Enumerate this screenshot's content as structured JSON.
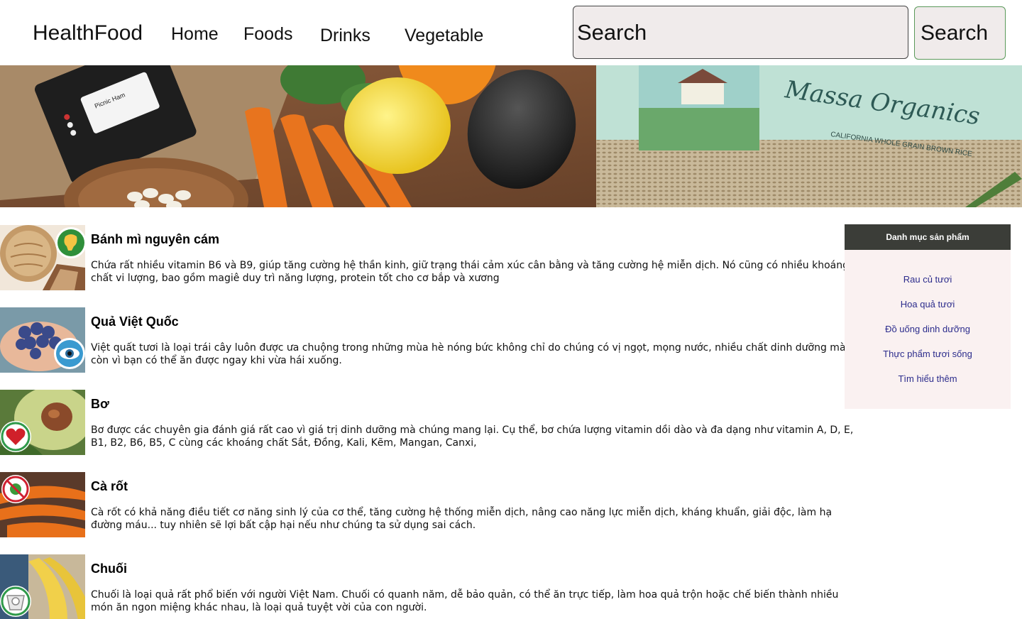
{
  "header": {
    "brand": "HealthFood",
    "nav": [
      "Home",
      "Foods",
      "Drinks",
      "Vegetable"
    ],
    "search_placeholder": "Search",
    "search_button": "Search"
  },
  "sidebar": {
    "title": "Danh mục sản phẩm",
    "links": [
      "Rau củ tươi",
      "Hoa quả tươi",
      "Đồ uống dinh dưỡng",
      "Thực phẩm tươi sống",
      "Tìm hiểu thêm"
    ]
  },
  "banner": {
    "label_picnic": "Picnic Ham",
    "label_brand": "Massa Organics",
    "label_rice": "CALIFORNIA WHOLE GRAIN BROWN RICE"
  },
  "articles": [
    {
      "title": "Bánh mì nguyên cám",
      "desc": "Chứa rất nhiều vitamin B6 và B9, giúp tăng cường hệ thần kinh, giữ trạng thái cảm xúc cân bằng và tăng cường hệ miễn dịch. Nó cũng có nhiều khoáng chất vi lượng, bao gồm magiê duy trì năng lượng, protein tốt cho cơ bắp và xương",
      "badge_icon": "brain-icon"
    },
    {
      "title": "Quả Việt Quốc",
      "desc": "Việt quất tươi là loại trái cây luôn được ưa chuộng trong những mùa hè nóng bức không chỉ do chúng có vị ngọt, mọng nước, nhiều chất dinh dưỡng mà còn vì bạn có thể ăn được ngay khi vừa hái xuống.",
      "badge_icon": "eye-icon"
    },
    {
      "title": "Bơ",
      "desc": "Bơ được các chuyên gia đánh giá rất cao vì giá trị dinh dưỡng mà chúng mang lại. Cụ thể, bơ chứa lượng vitamin dồi dào và đa dạng như vitamin A, D, E, B1, B2, B6, B5, C cùng các khoáng chất Sắt, Đồng, Kali, Kẽm, Mangan, Canxi,",
      "badge_icon": "heart-icon"
    },
    {
      "title": "Cà rốt",
      "desc": "Cà rốt có khả năng điều tiết cơ năng sinh lý của cơ thể, tăng cường hệ thống miễn dịch, nâng cao năng lực miễn dịch, kháng khuẩn, giải độc, làm hạ đường máu... tuy nhiên sẽ lợi bất cập hại nếu như chúng ta sử dụng sai cách.",
      "badge_icon": "no-virus-icon"
    },
    {
      "title": "Chuối",
      "desc": "Chuối là loại quả rất phổ biến với người Việt Nam. Chuối có quanh năm, dễ bảo quản, có thể ăn trực tiếp, làm hoa quả trộn hoặc chế biến thành nhiều món ăn ngon miệng khác nhau, là loại quả tuyệt vời của con người.",
      "badge_icon": "scale-icon"
    }
  ]
}
